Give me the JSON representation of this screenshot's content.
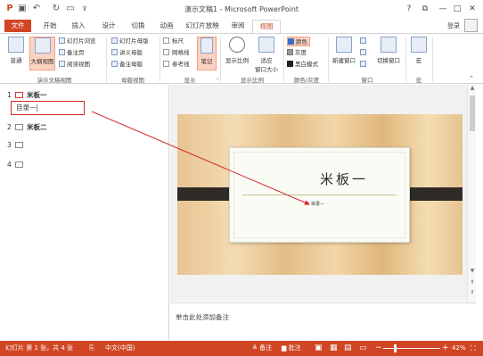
{
  "window": {
    "title": "演示文稿1 - Microsoft PowerPoint",
    "controls": {
      "help": "?",
      "restore": "⧉",
      "minimize": "—",
      "maximize": "□",
      "close": "✕"
    }
  },
  "quick_access": {
    "undo": "↶",
    "redo": "↻",
    "customize": "⊽"
  },
  "tabs": [
    {
      "label": "文件"
    },
    {
      "label": "开始"
    },
    {
      "label": "插入"
    },
    {
      "label": "设计"
    },
    {
      "label": "切换"
    },
    {
      "label": "动画"
    },
    {
      "label": "幻灯片放映"
    },
    {
      "label": "审阅"
    },
    {
      "label": "视图"
    }
  ],
  "account": {
    "login": "登录"
  },
  "ribbon": {
    "presentation_views": {
      "label": "演示文稿视图",
      "normal": "普通",
      "outline": "大纲视图",
      "slide_sorter": "幻灯片浏览",
      "notes_page": "备注页",
      "reading_view": "阅读视图"
    },
    "master_views": {
      "label": "母版视图",
      "slide_master": "幻灯片母版",
      "handout_master": "讲义母版",
      "notes_master": "备注母版"
    },
    "show": {
      "label": "显示",
      "ruler": "标尺",
      "gridlines": "网格线",
      "guides": "参考线",
      "notes": "笔记"
    },
    "zoom": {
      "label": "显示比例",
      "zoom": "显示比例",
      "fit": "适应",
      "fit2": "窗口大小"
    },
    "color": {
      "label": "颜色/灰度",
      "color": "颜色",
      "grayscale": "灰度",
      "bw": "黑白模式"
    },
    "window": {
      "label": "窗口",
      "new_window": "新建窗口",
      "switch": "切换窗口"
    },
    "macros": {
      "label": "宏",
      "macros": "宏"
    }
  },
  "outline": {
    "items": [
      {
        "num": "1",
        "text": "米板一"
      },
      {
        "num": "2",
        "text": "米板二"
      },
      {
        "num": "3",
        "text": ""
      },
      {
        "num": "4",
        "text": ""
      }
    ],
    "editing_text": "目录—|"
  },
  "slide": {
    "title": "米板一",
    "subtitle": "目录—"
  },
  "notes": {
    "placeholder": "单击此处添加备注"
  },
  "status": {
    "slide_info": "幻灯片 第 1 张，共 4 张",
    "language": "中文(中国)",
    "notes_btn": "≜ 备注",
    "comments_btn": "▆ 批注",
    "zoom_minus": "−",
    "zoom_plus": "+",
    "zoom_level": "42%",
    "zoom_fraction": 0.42
  },
  "colors": {
    "accent": "#d04625",
    "status_bar": "#d04625",
    "annotation": "#d42a2a"
  }
}
